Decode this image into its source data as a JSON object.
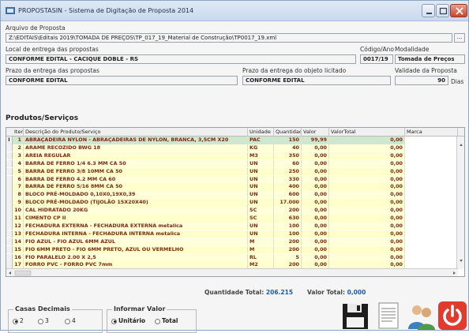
{
  "window": {
    "title": "PROPOSTASIN - Sistema de Digitação de Proposta 2014"
  },
  "form": {
    "arquivo_label": "Arquivo de Proposta",
    "arquivo_value": "Z:\\EDITAIS\\Editais 2019\\TOMADA DE PREÇOS\\TP_017_19_Material de Construção\\TP0017_19.xml",
    "browse_label": "...",
    "local_label": "Local de entrega das propostas",
    "local_value": "CONFORME EDITAL - CACIQUE DOBLE - RS",
    "codigo_label": "Código/Ano",
    "codigo_value": "0017/19",
    "modalidade_label": "Modalidade",
    "modalidade_value": "Tomada de Preços",
    "prazo_propostas_label": "Prazo da entrega das propostas",
    "prazo_propostas_value": "CONFORME EDITAL",
    "prazo_objeto_label": "Prazo da entrega do objeto licitado",
    "prazo_objeto_value": "CONFORME EDITAL",
    "validade_label": "Validade da Proposta",
    "validade_value": "90",
    "validade_unit": "Dias"
  },
  "grid": {
    "section_title": "Produtos/Serviços",
    "columns": [
      "Item",
      "Descrição do Produto/Serviço",
      "Unidade",
      "Quantidade",
      "Valor",
      "ValorTotal",
      "Marca"
    ],
    "row_indicator": "I",
    "rows": [
      {
        "item": "1",
        "desc": "ABRAÇADEIRA  NYLON - ABRAÇADEIRAS DE NYLON, BRANCA, 3,5CM X20",
        "un": "PAC",
        "qtd": "150",
        "valor": "99,99",
        "total": "0,00"
      },
      {
        "item": "2",
        "desc": "ARAME RECOZIDO BWG 18",
        "un": "KG",
        "qtd": "40",
        "valor": "0,00",
        "total": "0,00"
      },
      {
        "item": "3",
        "desc": "AREIA REGULAR",
        "un": "M3",
        "qtd": "350",
        "valor": "0,00",
        "total": "0,00"
      },
      {
        "item": "4",
        "desc": "BARRA DE FERRO 1/4 6.3 MM CA 50",
        "un": "UN",
        "qtd": "60",
        "valor": "0,00",
        "total": "0,00"
      },
      {
        "item": "5",
        "desc": "BARRA DE FERRO 3/8 10MM CA 50",
        "un": "UN",
        "qtd": "250",
        "valor": "0,00",
        "total": "0,00"
      },
      {
        "item": "6",
        "desc": "BARRA DE FERRO 4.2 MM CA 60",
        "un": "UN",
        "qtd": "330",
        "valor": "0,00",
        "total": "0,00"
      },
      {
        "item": "7",
        "desc": "BARRA DE FERRO 5/16 8MM CA 50",
        "un": "UN",
        "qtd": "400",
        "valor": "0,00",
        "total": "0,00"
      },
      {
        "item": "8",
        "desc": "BLOCO PRÉ-MOLDADO 0,10X0,19X0,39",
        "un": "UN",
        "qtd": "600",
        "valor": "0,00",
        "total": "0,00"
      },
      {
        "item": "9",
        "desc": "BLOCO PRÉ-MOLDADO (TIJOLÃO 15X20X40)",
        "un": "UN",
        "qtd": "17.000",
        "valor": "0,00",
        "total": "0,00"
      },
      {
        "item": "10",
        "desc": "CAL HIDRATADO 20KG",
        "un": "SC",
        "qtd": "200",
        "valor": "0,00",
        "total": "0,00"
      },
      {
        "item": "11",
        "desc": "CIMENTO CP II",
        "un": "SC",
        "qtd": "630",
        "valor": "0,00",
        "total": "0,00"
      },
      {
        "item": "12",
        "desc": "FECHADURA EXTERNA - FECHADURA EXTERNA metalica",
        "un": "UN",
        "qtd": "100",
        "valor": "0,00",
        "total": "0,00"
      },
      {
        "item": "13",
        "desc": "FECHADURA INTERNA - FECHADURA INTERNA metalica",
        "un": "UN",
        "qtd": "100",
        "valor": "0,00",
        "total": "0,00"
      },
      {
        "item": "14",
        "desc": "FIO AZUL - FIO AZUL 6MM AZUL",
        "un": "M",
        "qtd": "200",
        "valor": "0,00",
        "total": "0,00"
      },
      {
        "item": "15",
        "desc": "FIO 6MM PRETO - FIO 6MM PRETO, AZUL OU VERMELHO",
        "un": "M",
        "qtd": "200",
        "valor": "0,00",
        "total": "0,00"
      },
      {
        "item": "16",
        "desc": "FIO PARALELO 2.00 X 2,5",
        "un": "RL",
        "qtd": "5",
        "valor": "0,00",
        "total": "0,00"
      },
      {
        "item": "17",
        "desc": "FORRO PVC - FORRO PVC 7mm",
        "un": "M2",
        "qtd": "200",
        "valor": "0,00",
        "total": "0,00"
      }
    ]
  },
  "totals": {
    "qtd_label": "Quantidade Total:",
    "qtd_value": "206.215",
    "valor_label": "Valor Total:",
    "valor_value": "0,000"
  },
  "casas": {
    "title": "Casas Decimais",
    "options": [
      "2",
      "3",
      "4"
    ],
    "selected": "2"
  },
  "informar": {
    "title": "Informar Valor",
    "options": [
      "Unitário",
      "Total"
    ],
    "selected": "Unitário"
  },
  "colors": {
    "row_bg": "#ffffcc",
    "row_alt_bg": "#ffffd9",
    "selected_row_bg": "#cfe7cf",
    "row_text": "#7a2a12",
    "total_value": "#1c58b8"
  }
}
